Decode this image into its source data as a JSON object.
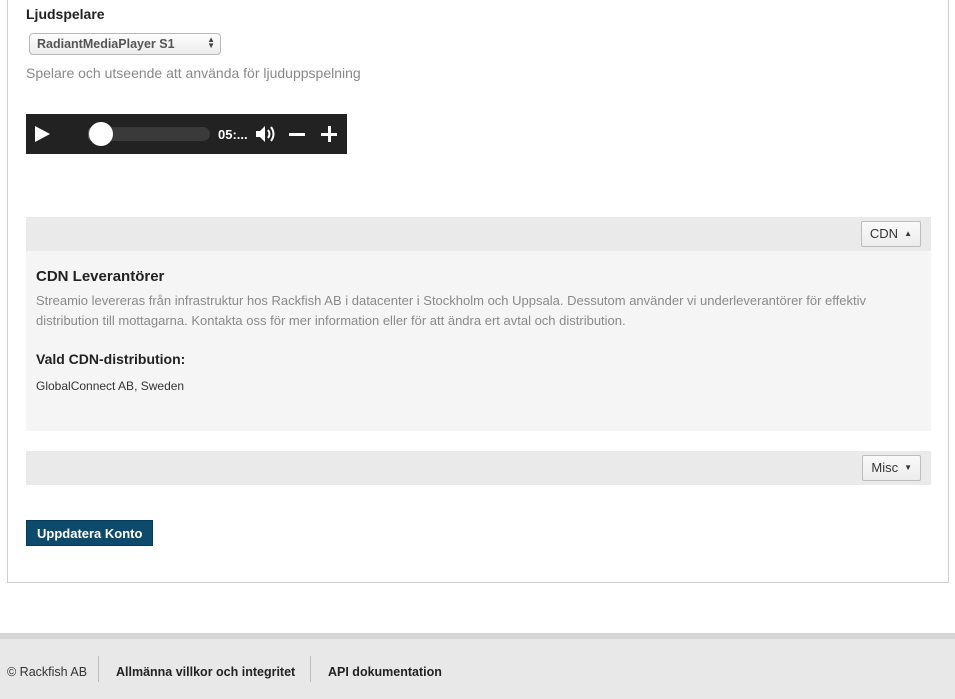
{
  "player": {
    "heading": "Ljudspelare",
    "selected_player": "RadiantMediaPlayer S1",
    "help_text": "Spelare och utseende att använda för ljuduppspelning",
    "time": "05:...",
    "progress": 0.07
  },
  "cdn_section": {
    "toggle_label": "CDN",
    "title": "CDN Leverantörer",
    "description": "Streamio levereras från infrastruktur hos Rackfish AB i datacenter i Stockholm och Uppsala. Dessutom använder vi underleverantörer för effektiv distribution till mottagarna. Kontakta oss för mer information eller för att ändra ert avtal och distribution.",
    "selected_label": "Vald CDN-distribution:",
    "selected_value": "GlobalConnect AB, Sweden"
  },
  "misc_section": {
    "toggle_label": "Misc"
  },
  "actions": {
    "update_label": "Uppdatera Konto"
  },
  "footer": {
    "copyright": "© Rackfish AB",
    "terms_link": "Allmänna villkor och integritet",
    "api_link": "API dokumentation"
  },
  "colors": {
    "primary_button": "#0d4a6b",
    "player_background": "#222222"
  }
}
